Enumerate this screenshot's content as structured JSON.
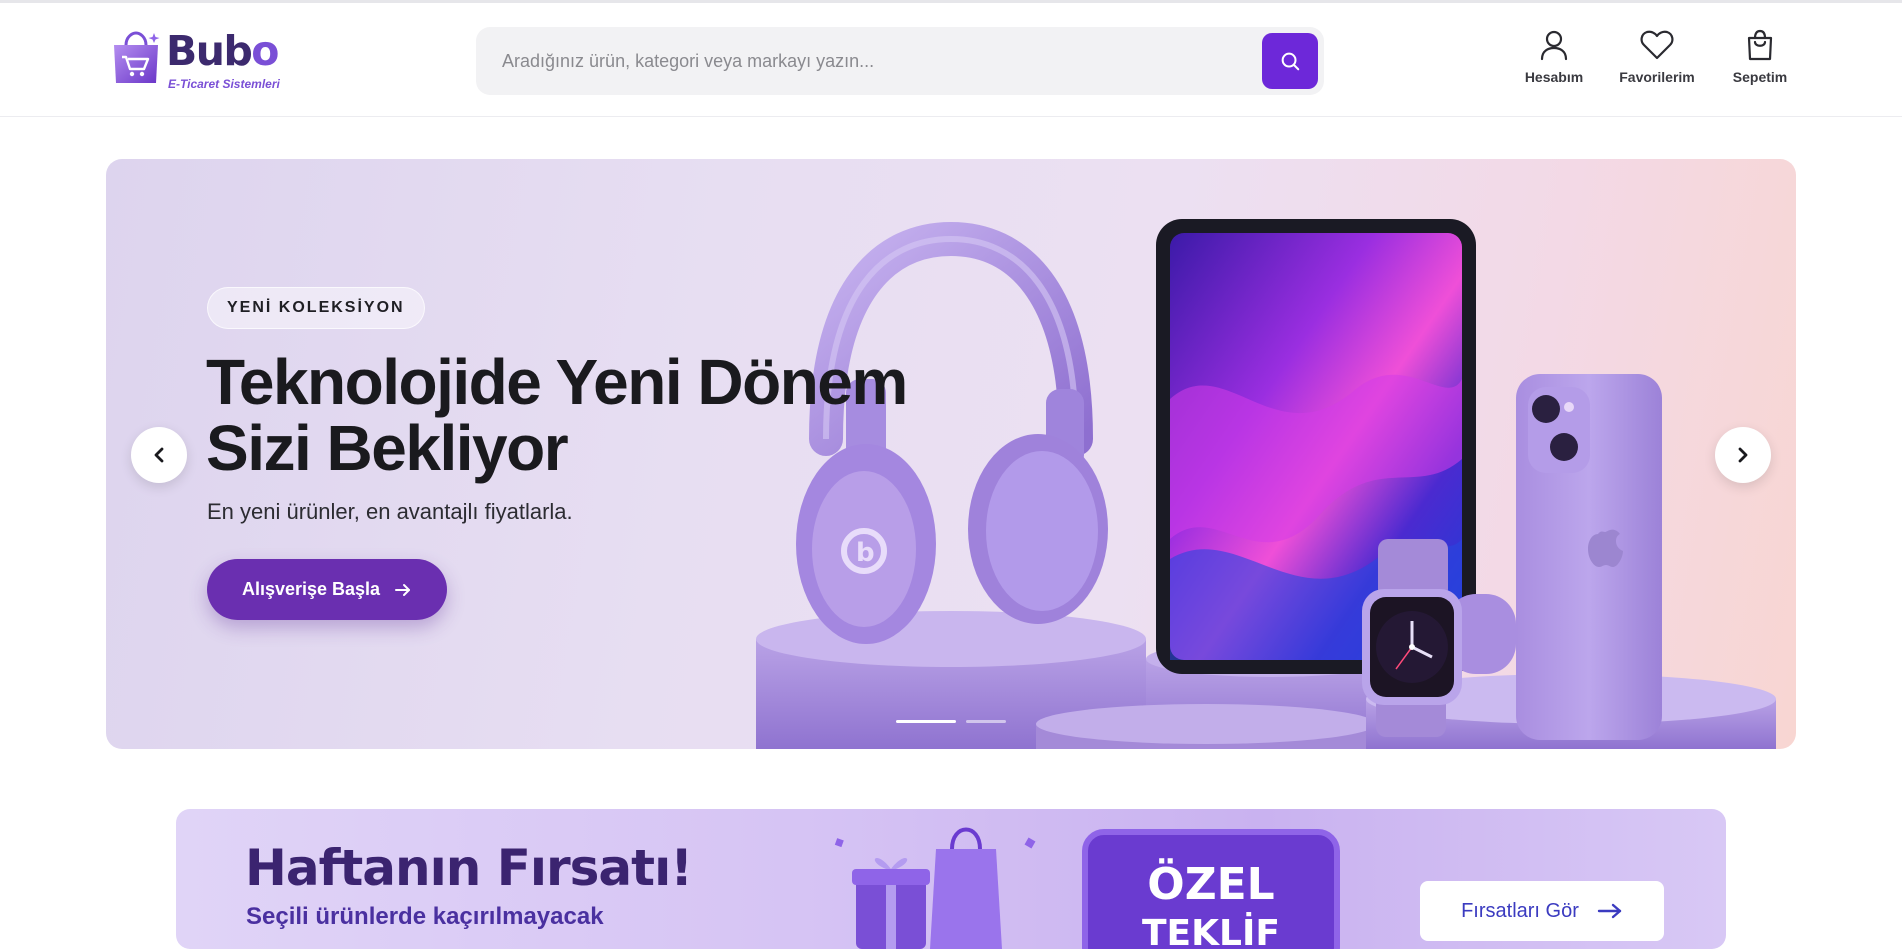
{
  "header": {
    "brand_main": "Bub",
    "brand_accent": "o",
    "brand_tagline": "E-Ticaret Sistemleri",
    "search_placeholder": "Aradığınız ürün, kategori veya markayı yazın...",
    "search_icon": "search-icon",
    "nav": [
      {
        "label": "Hesabım",
        "icon": "user-icon"
      },
      {
        "label": "Favorilerim",
        "icon": "heart-icon"
      },
      {
        "label": "Sepetim",
        "icon": "shopping-bag-icon"
      }
    ]
  },
  "hero": {
    "badge": "YENİ KOLEKSİYON",
    "title_line1": "Teknolojide Yeni Dönem",
    "title_line2": "Sizi Bekliyor",
    "subtitle": "En yeni ürünler, en avantajlı fiyatlarla.",
    "cta_label": "Alışverişe Başla",
    "slides_total": 2,
    "active_slide": 1
  },
  "promo": {
    "title": "Haftanın Fırsatı!",
    "subtitle": "Seçili ürünlerde kaçırılmayacak",
    "badge_line1": "ÖZEL",
    "badge_line2": "TEKLİF",
    "button_label": "Fırsatları Gör"
  },
  "colors": {
    "accent": "#6d28d9",
    "cta": "#6a2fb0",
    "brand_dark": "#3c2a6e"
  }
}
